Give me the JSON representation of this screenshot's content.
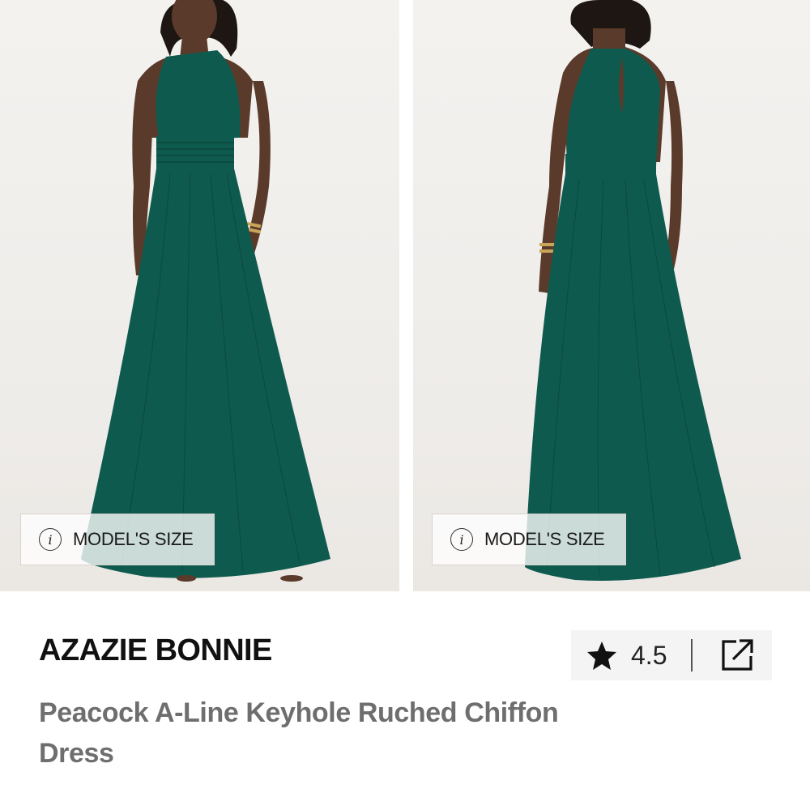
{
  "gallery": {
    "images": [
      {
        "icon": "dress-front-photo",
        "dress_color": "#0f5a4e"
      },
      {
        "icon": "dress-back-photo",
        "dress_color": "#0f5a4e"
      }
    ],
    "model_size_label": "MODEL'S SIZE",
    "info_glyph": "i"
  },
  "product": {
    "brand": "AZAZIE BONNIE",
    "name": "Peacock A-Line Keyhole Ruched Chiffon Dress",
    "rating": "4.5",
    "rating_icon": "star-icon",
    "share_icon": "share-external-icon"
  },
  "colors": {
    "dress": "#0f5a4e",
    "brand_text": "#111111",
    "name_text": "#6e6e6e",
    "rating_bg": "#f4f4f4"
  }
}
